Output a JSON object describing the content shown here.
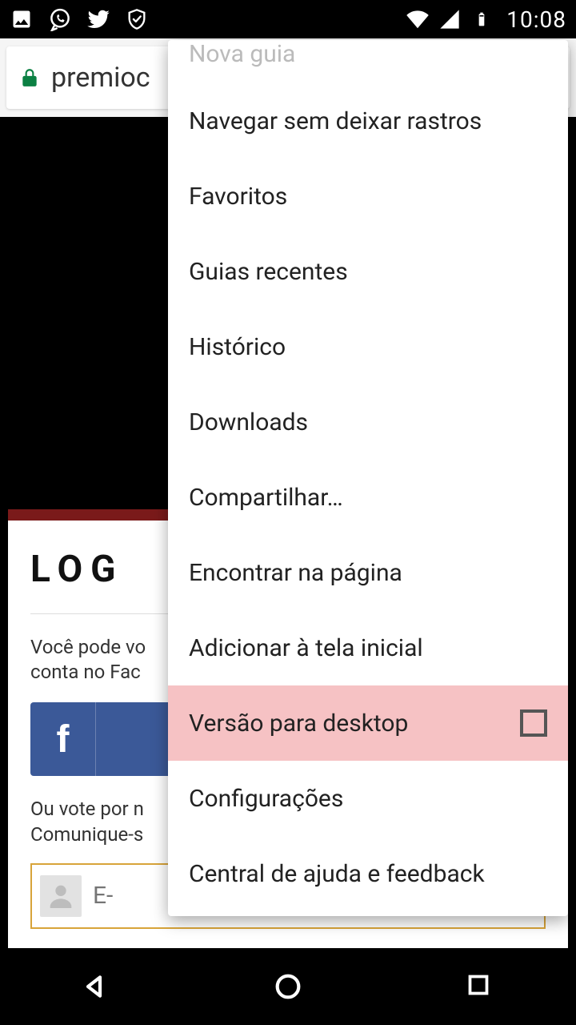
{
  "status": {
    "time": "10:08"
  },
  "urlbar": {
    "url": "premioc"
  },
  "page": {
    "login_title": "LOG",
    "login_desc1": "Você pode vo",
    "login_desc2": "conta no Fac",
    "or1": "Ou vote por n",
    "or2": "Comunique-s",
    "email_placeholder": "E-"
  },
  "menu": {
    "items": [
      {
        "label": "Nova guia",
        "faded": true
      },
      {
        "label": "Navegar sem deixar rastros"
      },
      {
        "label": "Favoritos"
      },
      {
        "label": "Guias recentes"
      },
      {
        "label": "Histórico"
      },
      {
        "label": "Downloads"
      },
      {
        "label": "Compartilhar…"
      },
      {
        "label": "Encontrar na página"
      },
      {
        "label": "Adicionar à tela inicial"
      },
      {
        "label": "Versão para desktop",
        "highlight": true,
        "checkbox": true,
        "checked": false
      },
      {
        "label": "Configurações"
      },
      {
        "label": "Central de ajuda e feedback"
      }
    ]
  }
}
